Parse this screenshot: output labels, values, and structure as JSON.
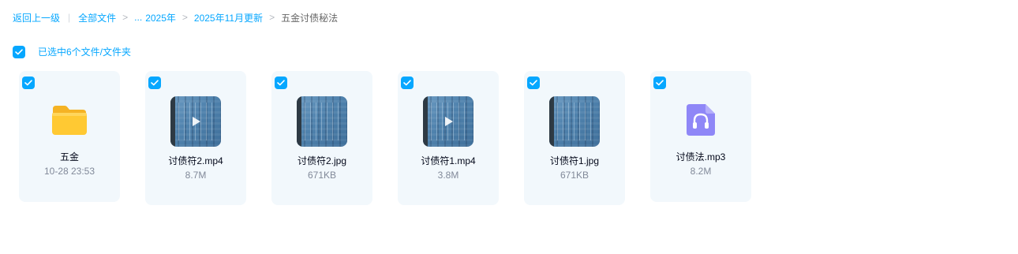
{
  "breadcrumb": {
    "back": "返回上一级",
    "root": "全部文件",
    "ellipsis": "...",
    "level1": "2025年",
    "level2": "2025年11月更新",
    "current": "五金讨债秘法"
  },
  "selection": {
    "label": "已选中6个文件/文件夹"
  },
  "colors": {
    "accent": "#06a7ff",
    "card_bg": "#f2f8fc",
    "folder": "#ffc933",
    "audio": "#8f87f7"
  },
  "files": [
    {
      "name": "五金",
      "meta": "10-28 23:53",
      "type": "folder",
      "icon": "folder-icon"
    },
    {
      "name": "讨债符2.mp4",
      "meta": "8.7M",
      "type": "video",
      "icon": "play-icon"
    },
    {
      "name": "讨债符2.jpg",
      "meta": "671KB",
      "type": "image"
    },
    {
      "name": "讨债符1.mp4",
      "meta": "3.8M",
      "type": "video",
      "icon": "play-icon"
    },
    {
      "name": "讨债符1.jpg",
      "meta": "671KB",
      "type": "image"
    },
    {
      "name": "讨债法.mp3",
      "meta": "8.2M",
      "type": "audio",
      "icon": "headphones-icon"
    }
  ]
}
